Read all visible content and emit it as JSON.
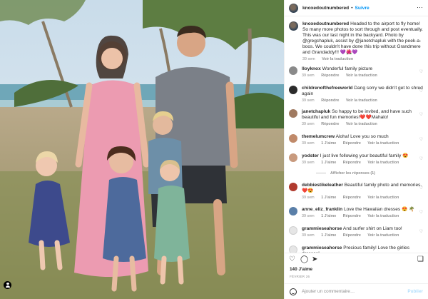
{
  "post": {
    "username": "knoxedoutnumbered",
    "follow_label": "Suivre",
    "more_label": "···",
    "caption": "Headed to the airport to fly home! So many more photos to sort through and post eventually. This was our last night in the backyard. Photo by @gregchapluk, assist by @janetchapluk with the peek-a-boos. We couldn't have done this trip without Grandmere and Grandaddy!!! 💜🌺💜",
    "caption_time": "39 sem",
    "see_translation": "Voir la traduction",
    "reply_label": "Répondre",
    "likes": "140 J'aime",
    "date": "FÉVRIER 26",
    "add_comment_placeholder": "Ajouter un commentaire…",
    "publish_label": "Publier"
  },
  "comments": [
    {
      "user": "lloyknox",
      "text": "Wonderful family picture",
      "time": "39 sem",
      "likes": ""
    },
    {
      "user": "childrenofthefreeworld",
      "text": "Dang sorry we didn't get to shred again",
      "time": "39 sem",
      "likes": ""
    },
    {
      "user": "janetchapluk",
      "text": "So happy to be invited, and have such beautiful and fun memories!❤️❤️Mahalo!",
      "time": "39 sem",
      "likes": ""
    },
    {
      "user": "themelumcrew",
      "text": "Aloha! Love you so much",
      "time": "39 sem",
      "likes": "1 J'aime"
    },
    {
      "user": "yodster",
      "text": "I just live following your beautiful family 😍",
      "time": "39 sem",
      "likes": "1 J'aime"
    },
    {
      "user": "debbiestikeleather",
      "text": "Beautiful family photo and memories. ❤️😍",
      "time": "39 sem",
      "likes": "1 J'aime"
    },
    {
      "user": "anne_eliz_franklin",
      "text": "Love the Hawaiian dresses 😍 🌴",
      "time": "39 sem",
      "likes": "1 J'aime"
    },
    {
      "user": "grammieseahorse",
      "text": "And surfer shirt on Liam too!",
      "time": "39 sem",
      "likes": "1 J'aime"
    },
    {
      "user": "grammieseahorse",
      "text": "Precious family! Love the girlies dresses!",
      "time": "",
      "likes": ""
    }
  ],
  "view_replies": "Afficher les réponses (1)",
  "icons": {
    "heart": "heart-icon",
    "comment": "comment-icon",
    "share": "share-icon",
    "save": "bookmark-icon",
    "emoji": "emoji-icon",
    "tag": "user-tag-icon"
  },
  "colors": {
    "accent": "#0095f6",
    "muted": "#8e8e8e",
    "text": "#262626",
    "publish_disabled": "#b2dffc"
  }
}
